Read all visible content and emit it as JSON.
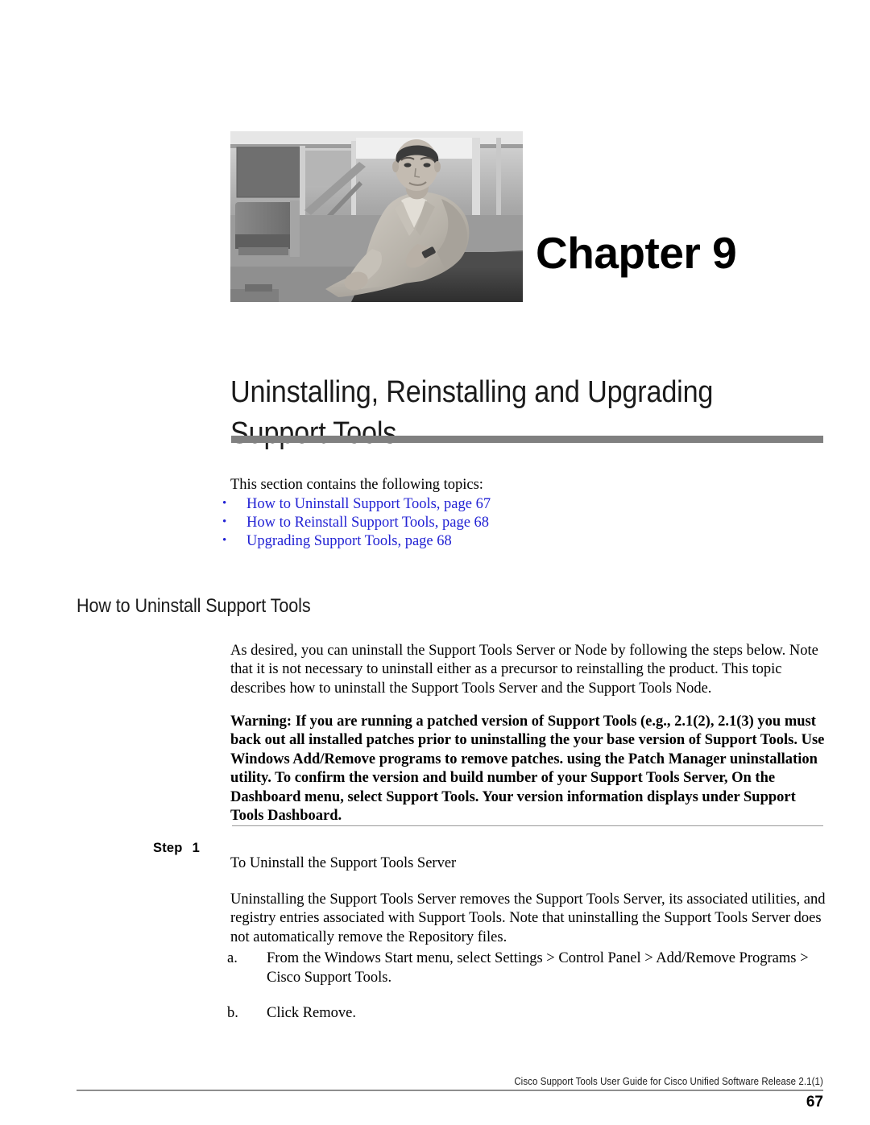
{
  "chapter": {
    "label": "Chapter 9",
    "title": "Uninstalling, Reinstalling and Upgrading Support Tools",
    "photo_alt": "seated-man-photo"
  },
  "intro": {
    "text": "This section contains the following topics:"
  },
  "topics": [
    {
      "label": "How to Uninstall Support Tools, page 67"
    },
    {
      "label": "How to Reinstall Support Tools, page 68"
    },
    {
      "label": "Upgrading Support Tools, page 68"
    }
  ],
  "section": {
    "heading": "How to Uninstall Support Tools",
    "paragraph": "As desired, you can uninstall the Support Tools Server or Node by following the steps below. Note that it is not necessary to uninstall either as a precursor to reinstalling the product. This topic describes how to uninstall the Support Tools Server and the Support Tools Node.",
    "warning": "Warning: If you are running a patched version of Support Tools (e.g., 2.1(2), 2.1(3) you must back out all installed patches prior to uninstalling the your base version of Support Tools. Use Windows Add/Remove programs to remove patches. using the Patch Manager uninstallation utility. To confirm the version and build number of your Support Tools Server, On the Dashboard menu, select Support Tools. Your version information displays under Support Tools Dashboard."
  },
  "step": {
    "label_word": "Step",
    "label_number": "1",
    "title": "To Uninstall the Support Tools Server",
    "body": "Uninstalling the Support Tools Server removes the Support Tools Server, its associated utilities, and registry entries associated with Support Tools. Note that uninstalling the Support Tools Server does not automatically remove the Repository files.",
    "substeps": [
      {
        "marker": "a.",
        "text": "From the Windows Start menu, select Settings > Control Panel > Add/Remove Programs > Cisco Support Tools."
      },
      {
        "marker": "b.",
        "text": "Click Remove."
      }
    ]
  },
  "footer": {
    "text": "Cisco Support Tools User Guide for Cisco Unified Software Release 2.1(1)",
    "page_number": "67"
  },
  "colors": {
    "link": "#2222d4",
    "title_rule": "#808080",
    "footer_rule": "#8f8f8f",
    "text": "#000000"
  }
}
